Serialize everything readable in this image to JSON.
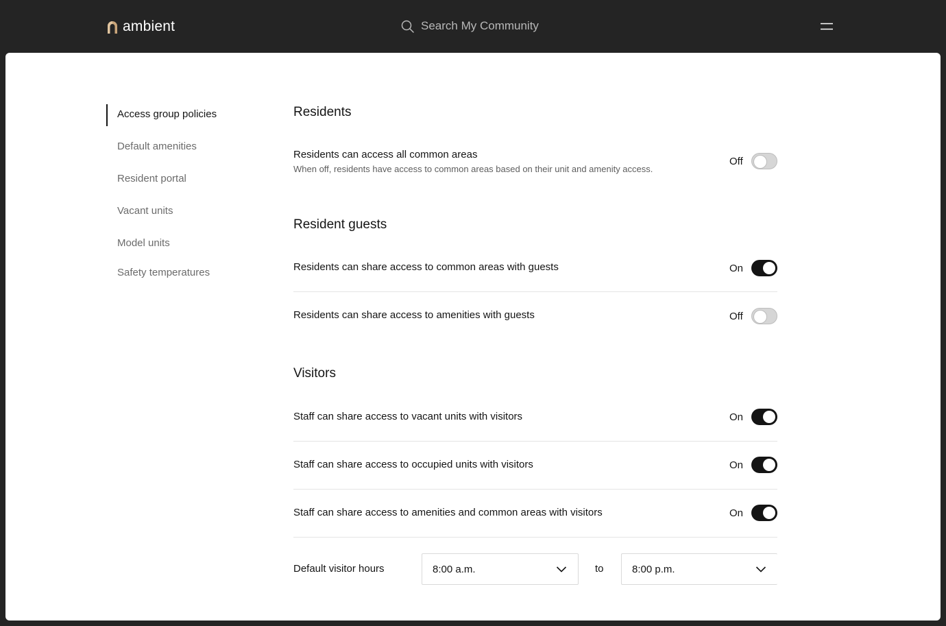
{
  "brand": {
    "name": "ambient",
    "accent": "#c9a57a"
  },
  "search": {
    "placeholder": "Search My Community"
  },
  "sidebar": {
    "items": [
      {
        "label": "Access group policies",
        "active": true
      },
      {
        "label": "Default amenities",
        "active": false
      },
      {
        "label": "Resident portal",
        "active": false
      },
      {
        "label": "Vacant units",
        "active": false
      },
      {
        "label": "Model units",
        "active": false
      },
      {
        "label": "Safety temperatures",
        "active": false
      }
    ]
  },
  "sections": {
    "residents": {
      "title": "Residents",
      "rows": [
        {
          "label": "Residents can access all common areas",
          "description": "When off, residents have access to common areas based on their unit and amenity access.",
          "state": "Off"
        }
      ]
    },
    "resident_guests": {
      "title": "Resident guests",
      "rows": [
        {
          "label": "Residents can share access to common areas with guests",
          "state": "On"
        },
        {
          "label": "Residents can share access to amenities with guests",
          "state": "Off"
        }
      ]
    },
    "visitors": {
      "title": "Visitors",
      "rows": [
        {
          "label": "Staff can share access to vacant units with visitors",
          "state": "On"
        },
        {
          "label": "Staff can share access to occupied units with visitors",
          "state": "On"
        },
        {
          "label": "Staff can share access to amenities and common areas with visitors",
          "state": "On"
        }
      ],
      "hours": {
        "label": "Default visitor hours",
        "from": "8:00 a.m.",
        "separator": "to",
        "to": "8:00 p.m."
      }
    }
  },
  "icons": {
    "search": "search-icon",
    "menu": "menu-icon",
    "chevron": "chevron-down-icon",
    "logo": "ambient-logo-icon"
  }
}
